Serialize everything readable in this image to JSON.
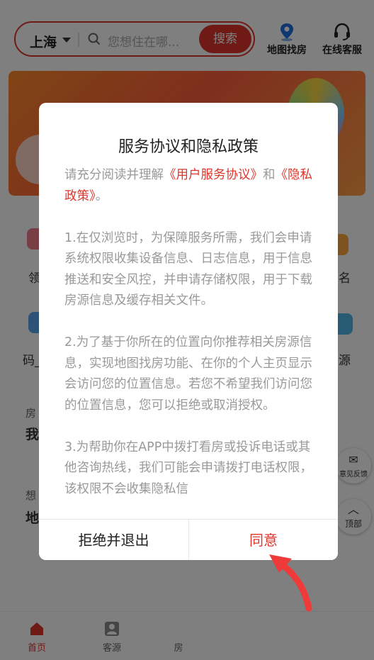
{
  "header": {
    "city": "上海",
    "search_placeholder": "您想住在哪...",
    "search_button": "搜索",
    "map_search": "地图找房",
    "customer_service": "在线客服"
  },
  "background": {
    "row1_left": "领",
    "row1_right": "名",
    "row2_left": "码_",
    "row2_right": "源",
    "card1_small": "房",
    "card1_big": "我",
    "card2_small": "想",
    "card2_big": "地",
    "feedback": "意见反馈",
    "top": "顶部"
  },
  "tabbar": {
    "tabs": [
      {
        "label": "首页",
        "active": true
      },
      {
        "label": "客源",
        "active": false
      },
      {
        "label": "房",
        "active": false
      }
    ]
  },
  "dialog": {
    "title": "服务协议和隐私政策",
    "intro_before": "请充分阅读并理解",
    "link_user_agreement": "《用户服务协议》",
    "intro_and": "和",
    "link_privacy": "《隐私政策》",
    "intro_end": "。",
    "para1": "1.在仅浏览时，为保障服务所需，我们会申请系统权限收集设备信息、日志信息，用于信息推送和安全风控，并申请存储权限，用于下载房源信息及缓存相关文件。",
    "para2": "2.为了基于你所在的位置向你推荐相关房源信息，实现地图找房功能、在你的个人主页显示会访问您的位置信息。若您不希望我们访问您的位置信息，您可以拒绝或取消授权。",
    "para3": "3.为帮助你在APP中拨打看房或投诉电话或其他咨询热线，我们可能会申请拨打电话权限，该权限不会收集隐私信",
    "reject_button": "拒绝并退出",
    "agree_button": "同意"
  },
  "colors": {
    "accent": "#e0352b",
    "overlay": "rgba(0,0,0,0.5)"
  }
}
